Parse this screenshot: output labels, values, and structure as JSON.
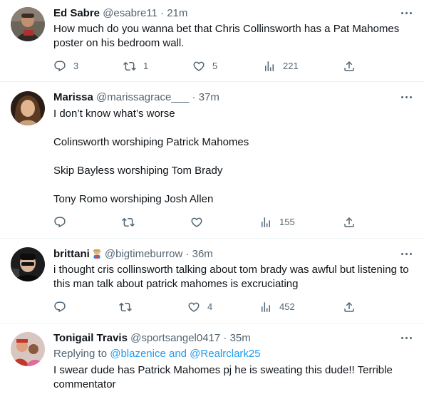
{
  "tweets": [
    {
      "name": "Ed Sabre",
      "handle": "@esabre11",
      "dot": "·",
      "time": "21m",
      "text": "How much do you wanna bet that Chris Collinsworth has a Pat Mahomes poster on his bedroom wall.",
      "replies": "3",
      "retweets": "1",
      "likes": "5",
      "views": "221"
    },
    {
      "name": "Marissa",
      "handle": "@marissagrace___",
      "dot": "·",
      "time": "37m",
      "text": "I don’t know what’s worse\n\nColinsworth worshiping Patrick Mahomes\n\nSkip Bayless worshiping Tom Brady\n\nTony Romo worshiping Josh Allen",
      "replies": "",
      "retweets": "",
      "likes": "",
      "views": "155"
    },
    {
      "name": "brittani",
      "handle": "@bigtimeburrow",
      "dot": "·",
      "time": "36m",
      "text": "i thought cris collinsworth talking about tom brady was awful but listening to this man talk about patrick mahomes is excruciating",
      "replies": "",
      "retweets": "",
      "likes": "4",
      "views": "452"
    },
    {
      "name": "Tonigail Travis",
      "handle": "@sportsangel0417",
      "dot": "·",
      "time": "35m",
      "reply_prefix": "Replying to",
      "reply_users": "@blazenice and @Realrclark25",
      "text": "I swear dude has Patrick Mahomes pj he is sweating this dude!! Terrible commentator"
    }
  ],
  "colors": {
    "text": "#0f1419",
    "secondary": "#536471",
    "link": "#1d9bf0",
    "divider": "#eff3f4"
  },
  "icons": [
    "reply-icon",
    "retweet-icon",
    "like-icon",
    "views-icon",
    "share-icon",
    "more-icon"
  ]
}
